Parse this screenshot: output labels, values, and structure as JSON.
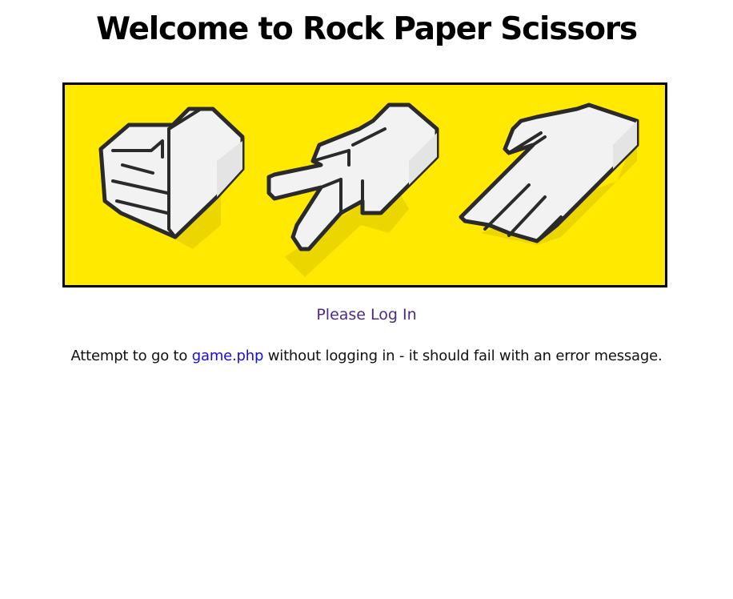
{
  "page": {
    "title": "Welcome to Rock Paper Scissors"
  },
  "banner": {
    "background": "#FFE900",
    "hands": [
      "rock-hand-icon",
      "scissors-hand-icon",
      "paper-hand-icon"
    ]
  },
  "login": {
    "label": "Please Log In",
    "color": "#4b2a8c"
  },
  "note": {
    "before": "Attempt to go to ",
    "link_text": "game.php",
    "after": " without logging in - it should fail with an error message.",
    "link_color": "#1a0dd6"
  }
}
